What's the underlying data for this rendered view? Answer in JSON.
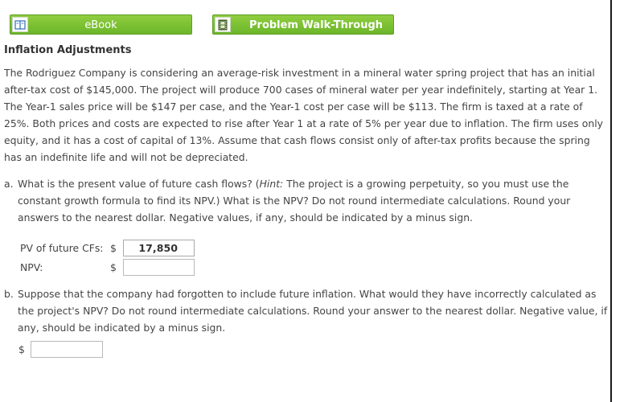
{
  "buttons": {
    "ebook_label": "eBook",
    "walkthrough_label": "Problem Walk-Through"
  },
  "title": "Inflation Adjustments",
  "problem_text": "The Rodriguez Company is considering an average-risk investment in a mineral water spring project that has an initial after-tax cost of $145,000. The project will produce 700 cases of mineral water per year indefinitely, starting at Year 1. The Year-1 sales price will be $147 per case, and the Year-1 cost per case will be $113. The firm is taxed at a rate of 25%. Both prices and costs are expected to rise after Year 1 at a rate of 5% per year due to inflation. The firm uses only equity, and it has a cost of capital of 13%. Assume that cash flows consist only of after-tax profits because the spring has an indefinite life and will not be depreciated.",
  "part_a": {
    "label": "a.",
    "text_before_hint": "What is the present value of future cash flows? (",
    "hint": "Hint:",
    "text_after_hint": " The project is a growing perpetuity, so you must use the constant growth formula to find its NPV.) What is the NPV? Do not round intermediate calculations. Round your answers to the nearest dollar. Negative values, if any, should be indicated by a minus sign.",
    "pv_label": "PV of future CFs:",
    "npv_label": "NPV:",
    "currency": "$",
    "pv_value": "17,850",
    "npv_value": ""
  },
  "part_b": {
    "label": "b.",
    "text": "Suppose that the company had forgotten to include future inflation. What would they have incorrectly calculated as the project's NPV? Do not round intermediate calculations. Round your answer to the nearest dollar. Negative value, if any, should be indicated by a minus sign.",
    "currency": "$",
    "value": ""
  }
}
